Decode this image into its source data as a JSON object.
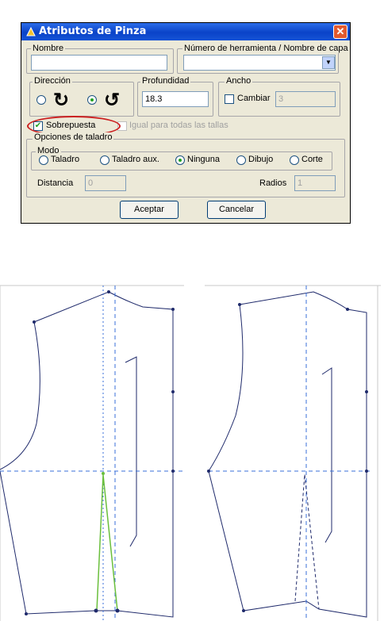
{
  "dialog": {
    "title": "Atributos de Pinza",
    "close_glyph": "✕",
    "nombre_label": "Nombre",
    "nombre_value": "",
    "herramienta_label": "Número de herramienta / Nombre de capa",
    "herramienta_value": "",
    "direccion_label": "Dirección",
    "profundidad_label": "Profundidad",
    "profundidad_value": "18.3",
    "ancho_label": "Ancho",
    "cambiar_label": "Cambiar",
    "ancho_value": "3",
    "sobrepuesta_label": "Sobrepuesta",
    "igual_label": "Igual para todas las tallas",
    "opciones_label": "Opciones de taladro",
    "modo_label": "Modo",
    "modes": [
      "Taladro",
      "Taladro aux.",
      "Ninguna",
      "Dibujo",
      "Corte"
    ],
    "selected_mode": "Ninguna",
    "distancia_label": "Distancia",
    "distancia_value": "0",
    "radios_label": "Radios",
    "radios_value": "1",
    "aceptar_label": "Aceptar",
    "cancelar_label": "Cancelar",
    "accent_color": "#0a43c8",
    "highlight_color": "#cc2020"
  },
  "pattern": {
    "line_color": "#1f2a6b",
    "dart_color": "#6abf3c",
    "guide_color": "#3a6fd8"
  }
}
